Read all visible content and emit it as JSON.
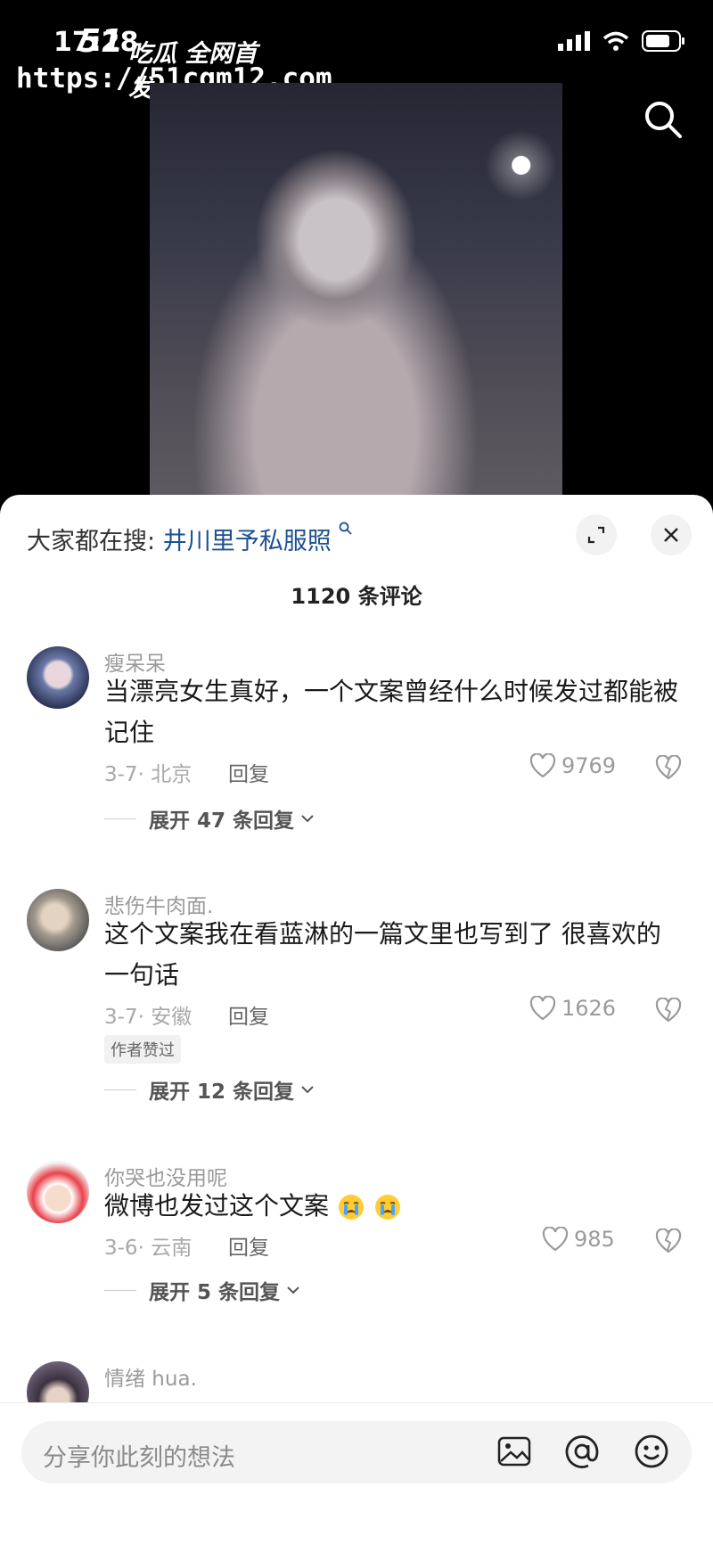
{
  "status": {
    "time": "17:28"
  },
  "watermark": {
    "brand": "51",
    "title": "吃瓜 全网首发",
    "url": "https://51cgm12.com"
  },
  "sheet": {
    "suggest_prefix": "大家都在搜:",
    "suggest_keyword": "井川里予私服照",
    "comment_count": "1120 条评论"
  },
  "comments": [
    {
      "user": "瘦呆呆",
      "line1": "当漂亮女生真好，一个文案曾经什么时候发过都能被",
      "line2": "记住",
      "meta": "3-7· 北京",
      "reply": "回复",
      "likes": "9769",
      "expand": "展开 47 条回复"
    },
    {
      "user": "悲伤牛肉面.",
      "line1": "这个文案我在看蓝淋的一篇文里也写到了 很喜欢的",
      "line2": "一句话",
      "meta": "3-7· 安徽",
      "reply": "回复",
      "likes": "1626",
      "badge": "作者赞过",
      "expand": "展开 12 条回复"
    },
    {
      "user": "你哭也没用呢",
      "line1": "微博也发过这个文案",
      "meta": "3-6· 云南",
      "reply": "回复",
      "likes": "985",
      "expand": "展开 5 条回复"
    },
    {
      "user": "情绪 hua."
    }
  ],
  "input": {
    "placeholder": "分享你此刻的想法"
  }
}
